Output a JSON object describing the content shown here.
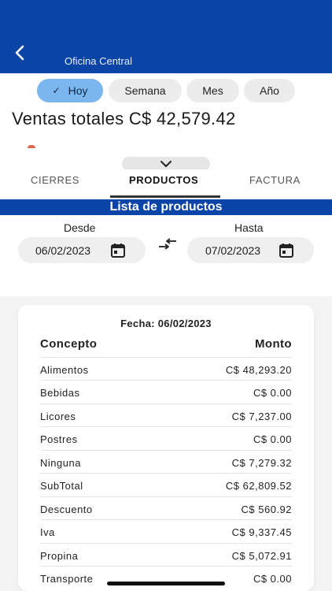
{
  "appbar": {
    "title": "Oficina Central"
  },
  "period_chips": [
    {
      "label": "Hoy",
      "selected": true
    },
    {
      "label": "Semana",
      "selected": false
    },
    {
      "label": "Mes",
      "selected": false
    },
    {
      "label": "Año",
      "selected": false
    }
  ],
  "summary": {
    "total_label": "Ventas totales C$ 42,579.42"
  },
  "tabs": [
    {
      "label": "CIERRES",
      "active": false
    },
    {
      "label": "PRODUCTOS",
      "active": true
    },
    {
      "label": "FACTURA",
      "active": false
    }
  ],
  "banner": {
    "title": "Lista de productos"
  },
  "date_range": {
    "from_label": "Desde",
    "from_value": "06/02/2023",
    "to_label": "Hasta",
    "to_value": "07/02/2023"
  },
  "report": {
    "date_line": "Fecha: 06/02/2023",
    "col_concept": "Concepto",
    "col_amount": "Monto",
    "rows": [
      {
        "concept": "Alimentos",
        "amount": "C$ 48,293.20"
      },
      {
        "concept": "Bebidas",
        "amount": "C$ 0.00"
      },
      {
        "concept": "Licores",
        "amount": "C$ 7,237.00"
      },
      {
        "concept": "Postres",
        "amount": "C$ 0.00"
      },
      {
        "concept": "Ninguna",
        "amount": "C$ 7,279.32"
      },
      {
        "concept": "SubTotal",
        "amount": "C$ 62,809.52"
      },
      {
        "concept": "Descuento",
        "amount": "C$ 560.92"
      },
      {
        "concept": "Iva",
        "amount": "C$ 9,337.45"
      },
      {
        "concept": "Propina",
        "amount": "C$ 5,072.91"
      },
      {
        "concept": "Transporte",
        "amount": "C$ 0.00"
      }
    ]
  },
  "colors": {
    "primary": "#0a44a6",
    "chip_selected": "#7cb6ee",
    "chip": "#ececec"
  },
  "icons": {
    "back": "chevron-left-icon",
    "expand": "chevron-down-icon",
    "swap": "swap-arrows-icon",
    "calendar": "calendar-icon",
    "check": "check-icon"
  }
}
